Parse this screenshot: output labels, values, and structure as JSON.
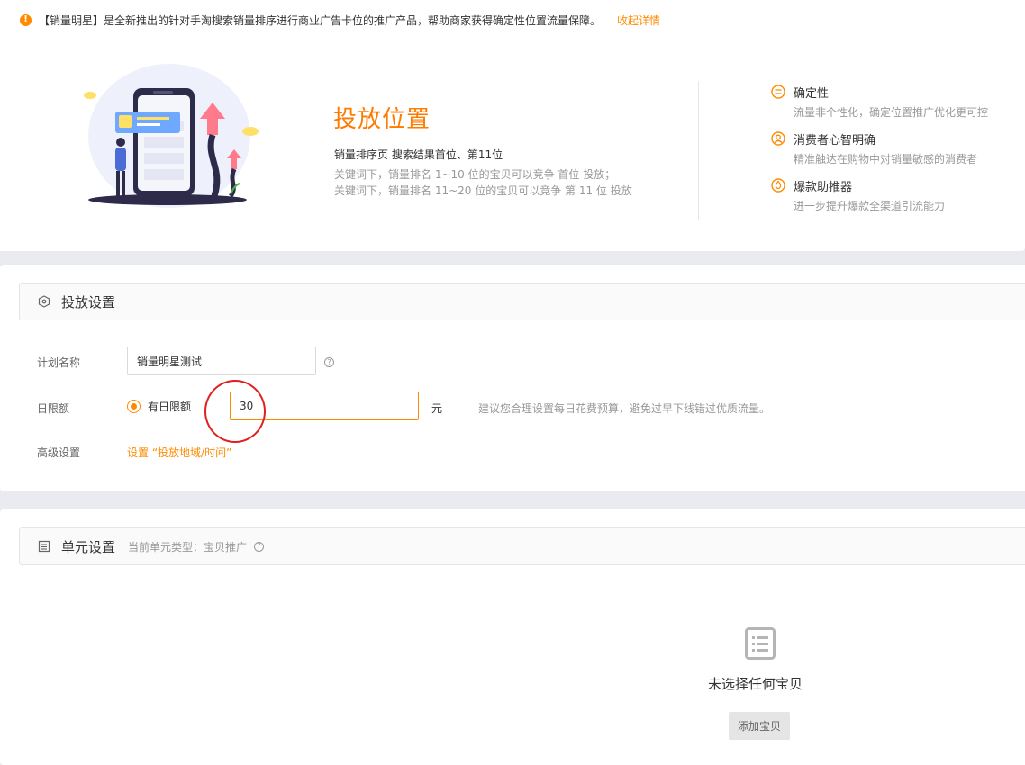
{
  "notice": {
    "text": "【销量明星】是全新推出的针对手淘搜索销量排序进行商业广告卡位的推广产品，帮助商家获得确定性位置流量保障。",
    "collapse_label": "收起详情",
    "icon": "info-icon"
  },
  "hero": {
    "title": "投放位置",
    "subtitle": "销量排序页 搜索结果首位、第11位",
    "desc_line1": "关键词下，销量排名 1~10 位的宝贝可以竞争 首位 投放；",
    "desc_line2": "关键词下，销量排名 11~20 位的宝贝可以竞争 第 11 位 投放"
  },
  "features": [
    {
      "title": "确定性",
      "desc": "流量非个性化，确定位置推广优化更可控",
      "icon": "certainty-icon"
    },
    {
      "title": "消费者心智明确",
      "desc": "精准触达在购物中对销量敏感的消费者",
      "icon": "consumer-icon"
    },
    {
      "title": "爆款助推器",
      "desc": "进一步提升爆款全渠道引流能力",
      "icon": "booster-icon"
    }
  ],
  "settings": {
    "section_title": "投放设置",
    "plan_name_label": "计划名称",
    "plan_name_value": "销量明星测试",
    "daily_limit_label": "日限额",
    "daily_limit_option": "有日限额",
    "daily_limit_value": "30",
    "unit": "元",
    "hint": "建议您合理设置每日花费预算，避免过早下线错过优质流量。",
    "advanced_label": "高级设置",
    "advanced_link": "设置 “投放地域/时间”"
  },
  "unit": {
    "section_title": "单元设置",
    "section_sub": "当前单元类型：宝贝推广",
    "empty_text": "未选择任何宝贝",
    "add_button": "添加宝贝"
  },
  "colors": {
    "accent": "#ff8a00",
    "annotation": "#e02020"
  }
}
